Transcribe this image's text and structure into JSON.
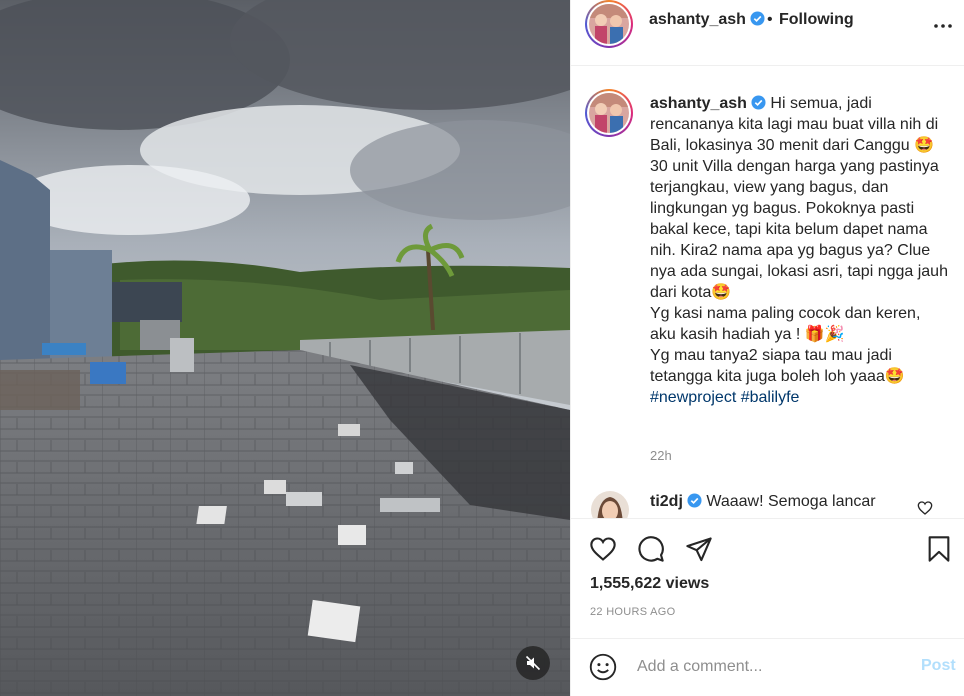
{
  "post": {
    "username": "ashanty_ash",
    "separator": "•",
    "follow_status": "Following",
    "caption": {
      "username": "ashanty_ash",
      "text": "Hi semua, jadi rencananya kita lagi mau buat villa nih di Bali, lokasinya 30 menit dari Canggu 🤩 30 unit Villa dengan harga yang pastinya terjangkau, view yang bagus, dan lingkungan yg bagus. Pokoknya pasti bakal kece, tapi kita belum dapet nama nih. Kira2 nama apa yg bagus ya? Clue nya ada sungai, lokasi asri, tapi ngga jauh dari kota🤩",
      "line2": "Yg kasi nama paling cocok dan keren, aku kasih hadiah ya ! 🎁🎉",
      "line3": "Yg mau tanya2 siapa tau mau jadi tetangga kita juga boleh loh yaaa🤩",
      "hashtags": [
        "#newproject",
        "#balilyfe"
      ],
      "time": "22h"
    },
    "comment": {
      "username": "ti2dj",
      "text": "Waaaw! Semoga lancar"
    },
    "views": "1,555,622 views",
    "time_ago": "22 HOURS AGO",
    "add_comment_placeholder": "Add a comment...",
    "post_label": "Post"
  },
  "icons": {
    "verified": "verified-badge-icon",
    "more": "more-options-icon",
    "like": "heart-icon",
    "comment": "comment-bubble-icon",
    "share": "paper-plane-icon",
    "save": "bookmark-icon",
    "emoji": "smiley-icon",
    "mute": "muted-speaker-icon"
  },
  "colors": {
    "verified": "#3897f0",
    "link": "#00376b",
    "muted_text": "#8e8e8e",
    "post_button": "#b2dffc"
  }
}
